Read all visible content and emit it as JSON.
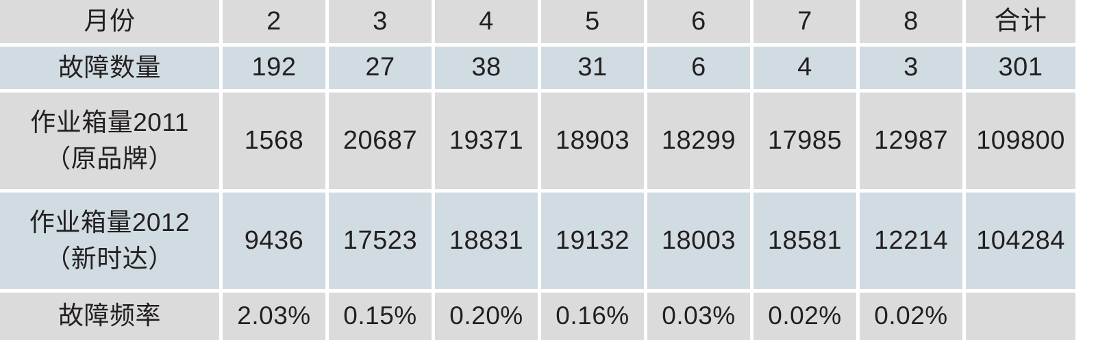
{
  "table": {
    "columns": [
      "月份",
      "2",
      "3",
      "4",
      "5",
      "6",
      "7",
      "8",
      "合计"
    ],
    "colors": {
      "header_bg": "#dbdbdb",
      "gray_bg": "#dbdbdb",
      "blue_bg": "#d0dce1",
      "gutter": "#ffffff",
      "text": "#231f20"
    },
    "rows": [
      {
        "id": "fault-count",
        "label": "故障数量",
        "label_line2": "",
        "style": "blue",
        "values": [
          "192",
          "27",
          "38",
          "31",
          "6",
          "4",
          "3"
        ],
        "total": "301"
      },
      {
        "id": "volume-2011",
        "label": "作业箱量2011",
        "label_line2": "（原品牌）",
        "style": "gray",
        "values": [
          "1568",
          "20687",
          "19371",
          "18903",
          "18299",
          "17985",
          "12987"
        ],
        "total": "109800"
      },
      {
        "id": "volume-2012",
        "label": "作业箱量2012",
        "label_line2": "（新时达）",
        "style": "blue",
        "values": [
          "9436",
          "17523",
          "18831",
          "19132",
          "18003",
          "18581",
          "12214"
        ],
        "total": "104284"
      },
      {
        "id": "fault-rate",
        "label": "故障频率",
        "label_line2": "",
        "style": "gray",
        "values": [
          "2.03%",
          "0.15%",
          "0.20%",
          "0.16%",
          "0.03%",
          "0.02%",
          "0.02%"
        ],
        "total": ""
      }
    ]
  },
  "chart_data": {
    "type": "table",
    "title": "",
    "categories": [
      "2",
      "3",
      "4",
      "5",
      "6",
      "7",
      "8"
    ],
    "category_label": "月份",
    "total_label": "合计",
    "series": [
      {
        "name": "故障数量",
        "values": [
          192,
          27,
          38,
          31,
          6,
          4,
          3
        ],
        "total": 301
      },
      {
        "name": "作业箱量2011（原品牌）",
        "values": [
          1568,
          20687,
          19371,
          18903,
          18299,
          17985,
          12987
        ],
        "total": 109800
      },
      {
        "name": "作业箱量2012（新时达）",
        "values": [
          9436,
          17523,
          18831,
          19132,
          18003,
          18581,
          12214
        ],
        "total": 104284
      },
      {
        "name": "故障频率",
        "values": [
          "2.03%",
          "0.15%",
          "0.20%",
          "0.16%",
          "0.03%",
          "0.02%",
          "0.02%"
        ],
        "total": ""
      }
    ]
  }
}
